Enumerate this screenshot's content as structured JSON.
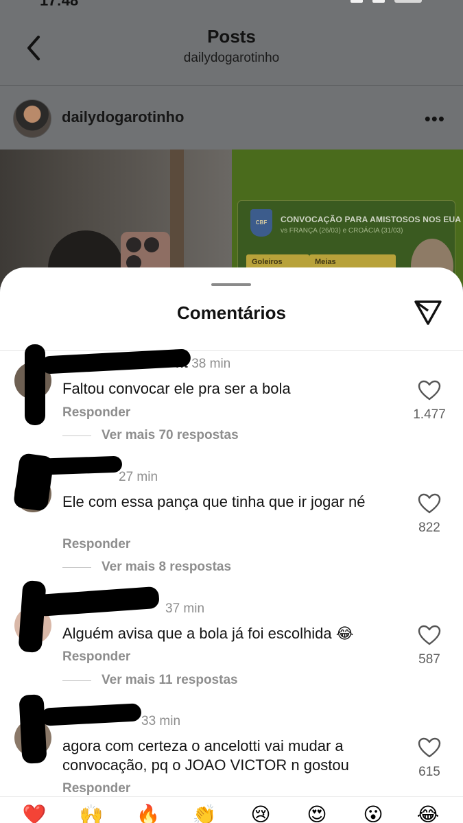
{
  "status_bar": {
    "time": "17:48"
  },
  "header": {
    "title": "Posts",
    "subtitle": "dailydogarotinho"
  },
  "post": {
    "username": "dailydogarotinho",
    "image_card": {
      "title": "CONVOCAÇÃO PARA AMISTOSOS NOS EUA",
      "subtitle": "vs FRANÇA (26/03) e CROÁCIA (31/03)",
      "pill_1": "Goleiros",
      "pill_2": "Meias",
      "logo_text": "CBF"
    }
  },
  "sheet": {
    "title": "Comentários"
  },
  "comments": [
    {
      "username": "nt",
      "time": "38 min",
      "text": "Faltou convocar ele pra ser a bola",
      "reply_label": "Responder",
      "more_replies": "Ver mais 70 respostas",
      "likes": "1.477"
    },
    {
      "username": "",
      "time": "27 min",
      "text": "Ele com essa pança que tinha que ir jogar né",
      "reply_label": "Responder",
      "more_replies": "Ver mais 8 respostas",
      "likes": "822"
    },
    {
      "username": "",
      "time": "37 min",
      "text": "Alguém avisa que a bola já foi escolhida 😂",
      "reply_label": "Responder",
      "more_replies": "Ver mais 11 respostas",
      "likes": "587"
    },
    {
      "username": "",
      "time": "33 min",
      "text": "agora com certeza o ancelotti vai mudar a convocação, pq o JOAO VICTOR n gostou",
      "reply_label": "Responder",
      "likes": "615"
    }
  ],
  "emoji_bar": [
    "❤️",
    "🙌",
    "🔥",
    "👏",
    "😢",
    "😍",
    "😮",
    "😂"
  ],
  "colors": {
    "overlay_bg": "#707274",
    "sheet_bg": "#ffffff",
    "secondary_text": "#8d8d8d",
    "primary_text": "#141414"
  }
}
